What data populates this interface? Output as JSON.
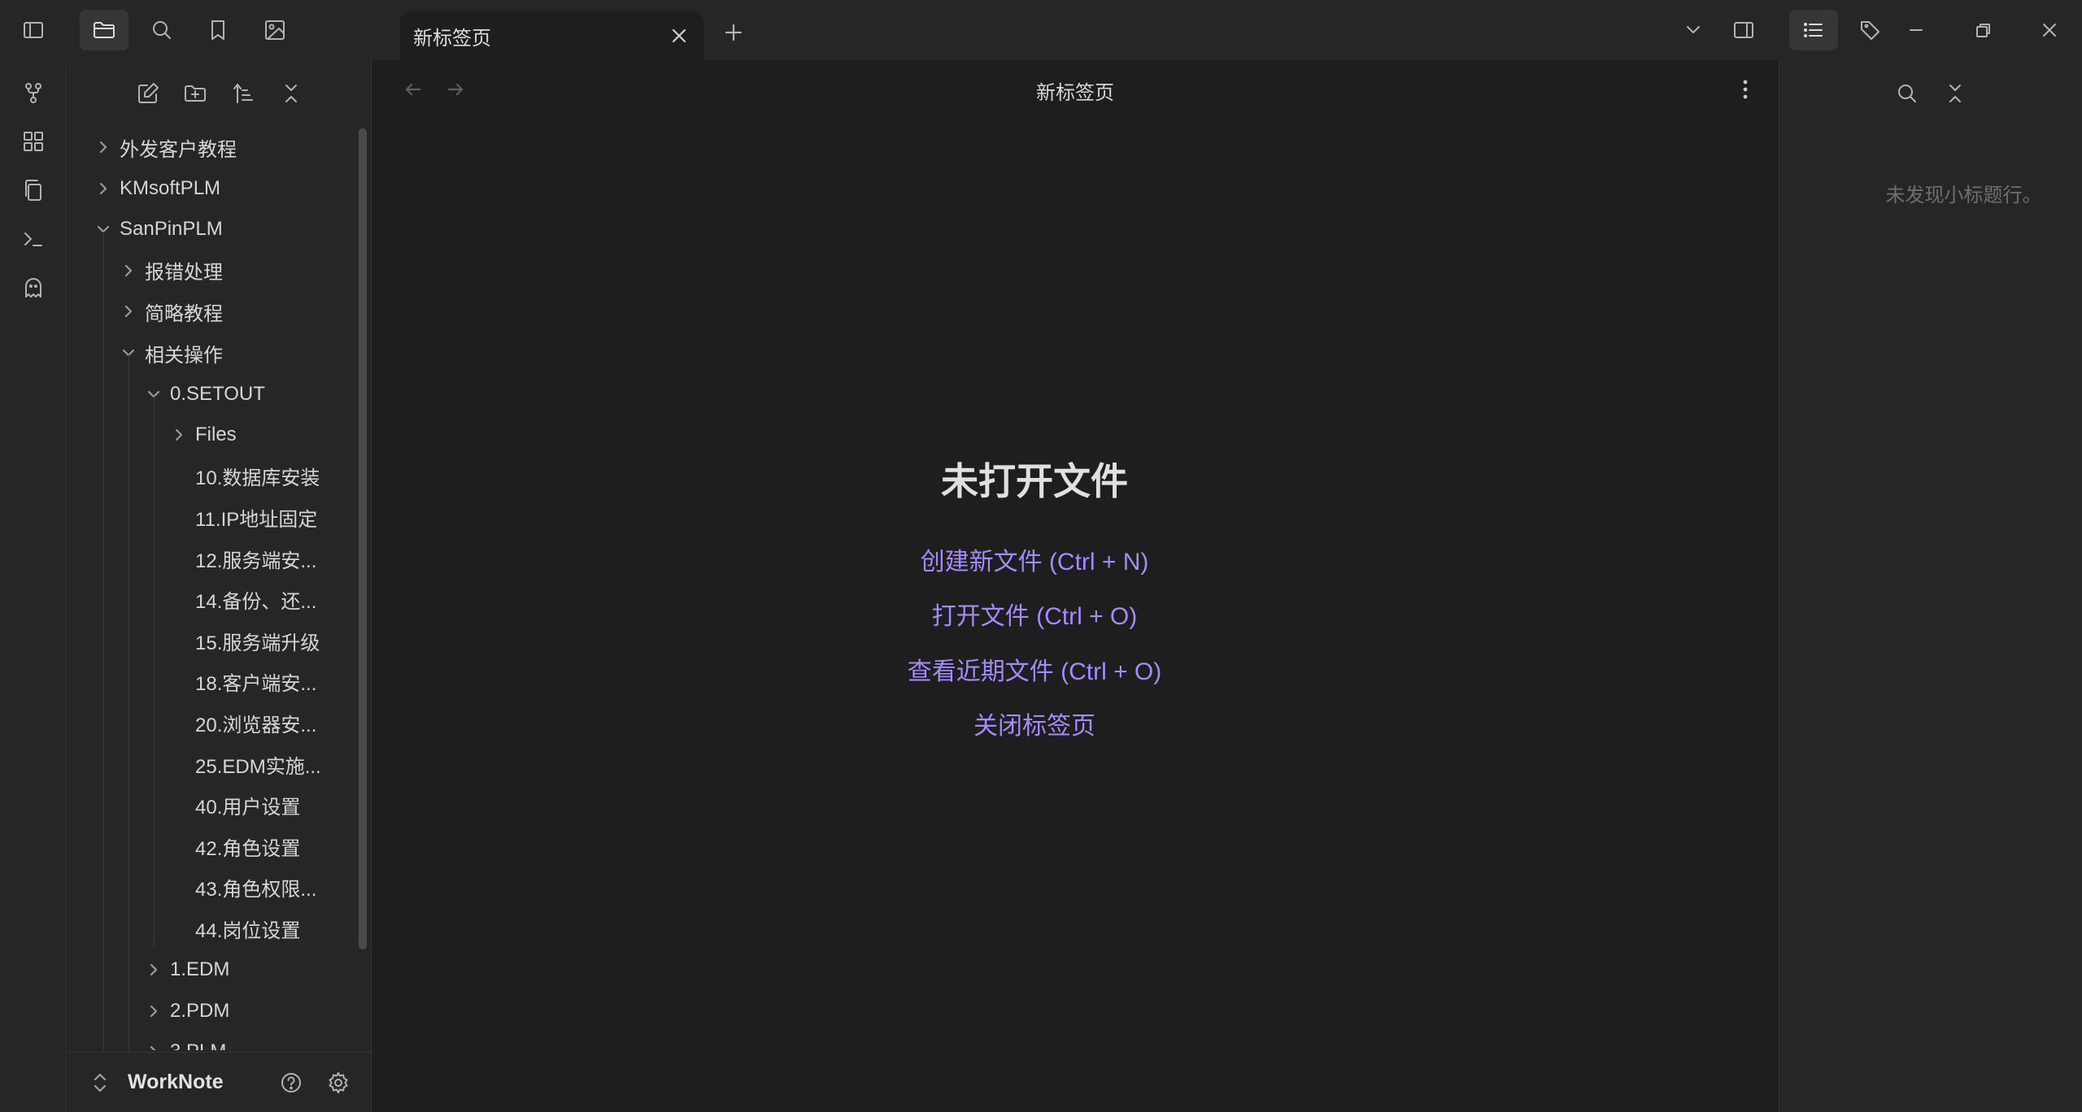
{
  "tab": {
    "title": "新标签页"
  },
  "explorer": {
    "tree": [
      {
        "label": "外发客户教程",
        "type": "folder",
        "expanded": false
      },
      {
        "label": "KMsoftPLM",
        "type": "folder",
        "expanded": false
      },
      {
        "label": "SanPinPLM",
        "type": "folder",
        "expanded": true
      },
      {
        "label": "报错处理",
        "type": "folder",
        "expanded": false
      },
      {
        "label": "简略教程",
        "type": "folder",
        "expanded": false
      },
      {
        "label": "相关操作",
        "type": "folder",
        "expanded": true
      },
      {
        "label": "0.SETOUT",
        "type": "folder",
        "expanded": true
      },
      {
        "label": "Files",
        "type": "folder",
        "expanded": false
      },
      {
        "label": "10.数据库安装",
        "type": "file"
      },
      {
        "label": "11.IP地址固定",
        "type": "file"
      },
      {
        "label": "12.服务端安...",
        "type": "file"
      },
      {
        "label": "14.备份、还...",
        "type": "file"
      },
      {
        "label": "15.服务端升级",
        "type": "file"
      },
      {
        "label": "18.客户端安...",
        "type": "file"
      },
      {
        "label": "20.浏览器安...",
        "type": "file"
      },
      {
        "label": "25.EDM实施...",
        "type": "file"
      },
      {
        "label": "40.用户设置",
        "type": "file"
      },
      {
        "label": "42.角色设置",
        "type": "file"
      },
      {
        "label": "43.角色权限...",
        "type": "file"
      },
      {
        "label": "44.岗位设置",
        "type": "file"
      },
      {
        "label": "1.EDM",
        "type": "folder",
        "expanded": false
      },
      {
        "label": "2.PDM",
        "type": "folder",
        "expanded": false
      },
      {
        "label": "3.PLM",
        "type": "folder",
        "expanded": false
      }
    ],
    "vault_name": "WorkNote"
  },
  "main": {
    "view_title": "新标签页",
    "empty_title": "未打开文件",
    "actions": [
      "创建新文件 (Ctrl + N)",
      "打开文件 (Ctrl + O)",
      "查看近期文件 (Ctrl + O)",
      "关闭标签页"
    ]
  },
  "outline": {
    "empty_text": "未发现小标题行。"
  },
  "colors": {
    "accent": "#a68af9",
    "background": "#1e1e1e",
    "panel": "#262626"
  }
}
